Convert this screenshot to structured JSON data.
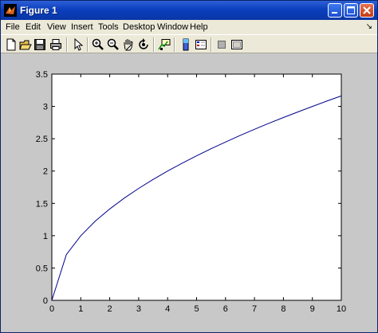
{
  "window": {
    "title": "Figure 1"
  },
  "menu": [
    "File",
    "Edit",
    "View",
    "Insert",
    "Tools",
    "Desktop",
    "Window",
    "Help"
  ],
  "toolbar": [
    "new-figure-icon",
    "open-icon",
    "save-icon",
    "print-icon",
    "pointer-icon",
    "zoom-in-icon",
    "zoom-out-icon",
    "pan-icon",
    "rotate-3d-icon",
    "data-cursor-icon",
    "colorbar-icon",
    "legend-icon",
    "hide-plot-tools-icon",
    "show-plot-tools-icon"
  ],
  "colors": {
    "line": "#00008b",
    "figure_bg": "#c8c8c8",
    "axes_bg": "#ffffff"
  },
  "chart_data": {
    "type": "line",
    "title": "",
    "xlabel": "",
    "ylabel": "",
    "xlim": [
      0,
      10
    ],
    "ylim": [
      0,
      3.5
    ],
    "xticks": [
      0,
      1,
      2,
      3,
      4,
      5,
      6,
      7,
      8,
      9,
      10
    ],
    "yticks": [
      0,
      0.5,
      1,
      1.5,
      2,
      2.5,
      3,
      3.5
    ],
    "xtick_labels": [
      "0",
      "1",
      "2",
      "3",
      "4",
      "5",
      "6",
      "7",
      "8",
      "9",
      "10"
    ],
    "ytick_labels": [
      "0",
      "0.5",
      "1",
      "1.5",
      "2",
      "2.5",
      "3",
      "3.5"
    ],
    "grid": false,
    "series": [
      {
        "x": [
          0,
          0.5,
          1,
          1.5,
          2,
          2.5,
          3,
          3.5,
          4,
          4.5,
          5,
          5.5,
          6,
          6.5,
          7,
          7.5,
          8,
          8.5,
          9,
          9.5,
          10
        ],
        "y": [
          0,
          0.707,
          1.0,
          1.225,
          1.414,
          1.581,
          1.732,
          1.871,
          2.0,
          2.121,
          2.236,
          2.345,
          2.449,
          2.55,
          2.646,
          2.739,
          2.828,
          2.915,
          3.0,
          3.082,
          3.162
        ]
      }
    ]
  }
}
